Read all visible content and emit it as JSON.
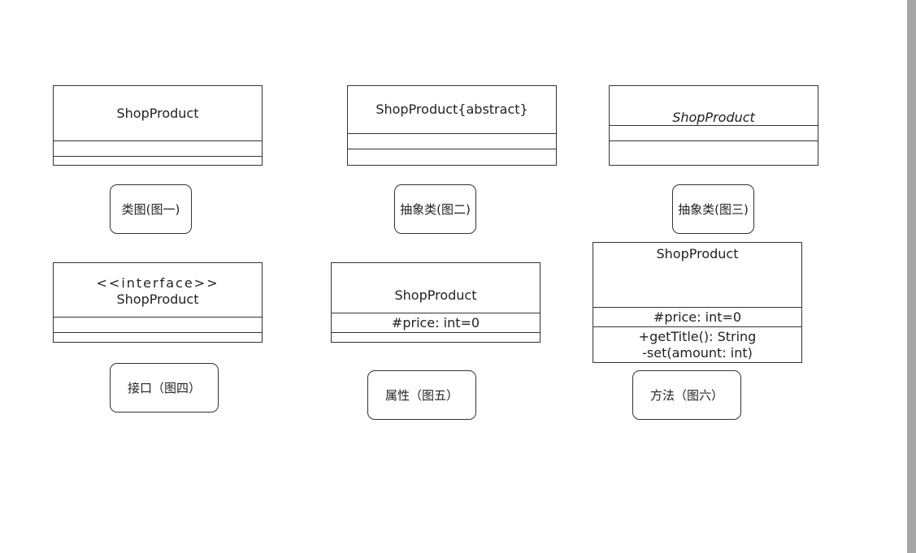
{
  "scrollbar_color": "#a6a6a6",
  "diagrams": {
    "class": {
      "name": "ShopProduct",
      "caption": "类图(图一)"
    },
    "abstract_a": {
      "name": "ShopProduct{abstract}",
      "caption": "抽象类(图二)"
    },
    "abstract_b": {
      "name": "ShopProduct",
      "caption": "抽象类(图三)"
    },
    "interface": {
      "stereotype": "<<interface>>",
      "name": "ShopProduct",
      "caption": "接口（图四）"
    },
    "attribute": {
      "name": "ShopProduct",
      "attribute": "#price: int=0",
      "caption": "属性（图五）"
    },
    "method": {
      "name": "ShopProduct",
      "attribute": "#price: int=0",
      "methods": [
        "+getTitle(): String",
        "-set(amount: int)"
      ],
      "caption": "方法（图六）"
    }
  }
}
